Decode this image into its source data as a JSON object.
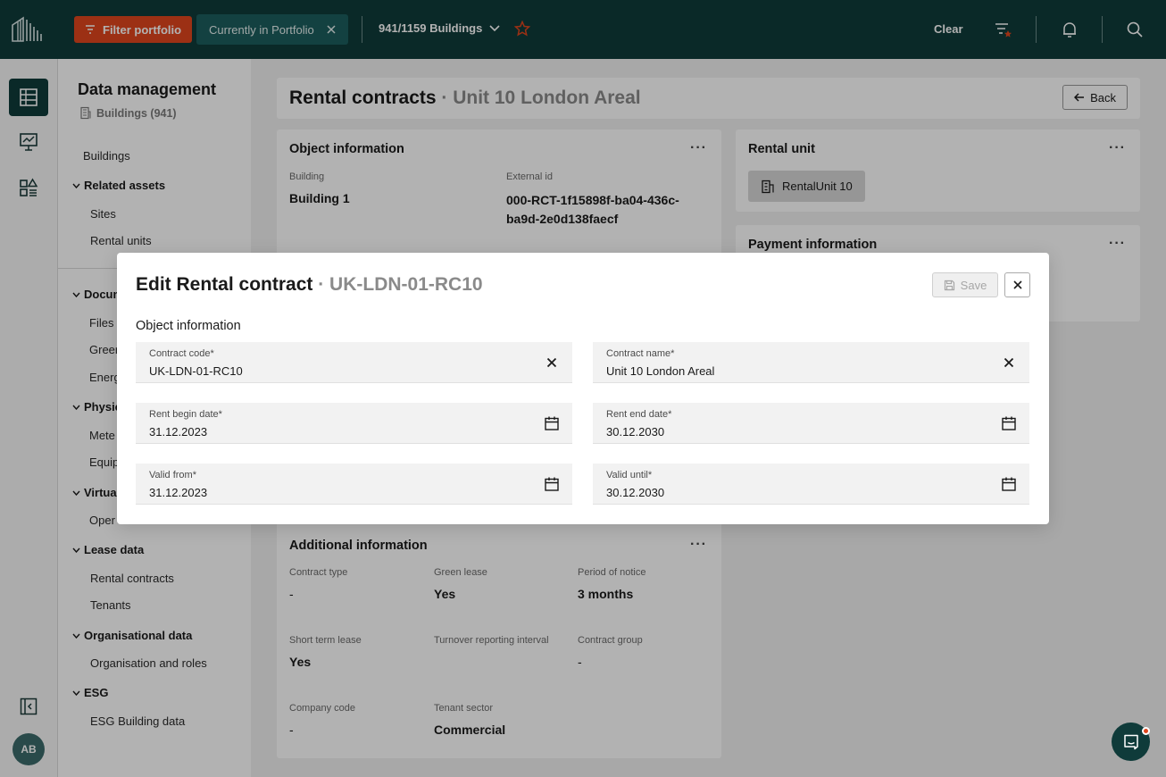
{
  "topbar": {
    "filter_label": "Filter portfolio",
    "chip_label": "Currently in Portfolio",
    "buildings_count": "941/1159 Buildings",
    "clear_label": "Clear"
  },
  "rail": {
    "avatar_initials": "AB"
  },
  "sidebar": {
    "title": "Data management",
    "subtitle": "Buildings (941)",
    "items": {
      "buildings": "Buildings",
      "related_assets": "Related assets",
      "sites": "Sites",
      "rental_units": "Rental units",
      "documents": "Docum",
      "files": "Files",
      "green": "Greer",
      "energy": "Energ",
      "physical": "Physic",
      "meters": "Mete",
      "equipment": "Equip",
      "virtual": "Virtua",
      "operational": "Oper",
      "lease_data": "Lease data",
      "rental_contracts": "Rental contracts",
      "tenants": "Tenants",
      "organisational_data": "Organisational data",
      "organisation_roles": "Organisation and roles",
      "esg": "ESG",
      "esg_building": "ESG Building data"
    }
  },
  "header": {
    "title": "Rental contracts",
    "separator": " · ",
    "subtitle": "Unit 10 London Areal",
    "back_label": "Back"
  },
  "object_info": {
    "title": "Object information",
    "building_label": "Building",
    "building_value": "Building 1",
    "external_id_label": "External id",
    "external_id_value": "000-RCT-1f15898f-ba04-436c-ba9d-2e0d138faecf"
  },
  "rental_unit": {
    "title": "Rental unit",
    "chip": "RentalUnit 10"
  },
  "payment_info": {
    "title": "Payment information"
  },
  "additional_info": {
    "title": "Additional information",
    "fields": [
      {
        "label": "Contract type",
        "value": "-"
      },
      {
        "label": "Green lease",
        "value": "Yes"
      },
      {
        "label": "Period of notice",
        "value": "3 months"
      },
      {
        "label": "Short term lease",
        "value": "Yes"
      },
      {
        "label": "Turnover reporting interval",
        "value": ""
      },
      {
        "label": "Contract group",
        "value": "-"
      },
      {
        "label": "Company code",
        "value": "-"
      },
      {
        "label": "Tenant sector",
        "value": "Commercial"
      }
    ]
  },
  "card_menu": "···",
  "modal": {
    "title": "Edit Rental contract",
    "separator": " · ",
    "code": "UK-LDN-01-RC10",
    "save_label": "Save",
    "section_title": "Object information",
    "fields": {
      "contract_code": {
        "label": "Contract code*",
        "value": "UK-LDN-01-RC10"
      },
      "contract_name": {
        "label": "Contract name*",
        "value": "Unit 10 London Areal"
      },
      "rent_begin": {
        "label": "Rent begin date*",
        "value": "31.12.2023"
      },
      "rent_end": {
        "label": "Rent end date*",
        "value": "30.12.2030"
      },
      "valid_from": {
        "label": "Valid from*",
        "value": "31.12.2023"
      },
      "valid_until": {
        "label": "Valid until*",
        "value": "30.12.2030"
      }
    }
  },
  "colors": {
    "topbar_bg": "#0f3b3a",
    "accent_orange": "#e0461d",
    "chip_bg": "#1c5e5d"
  }
}
